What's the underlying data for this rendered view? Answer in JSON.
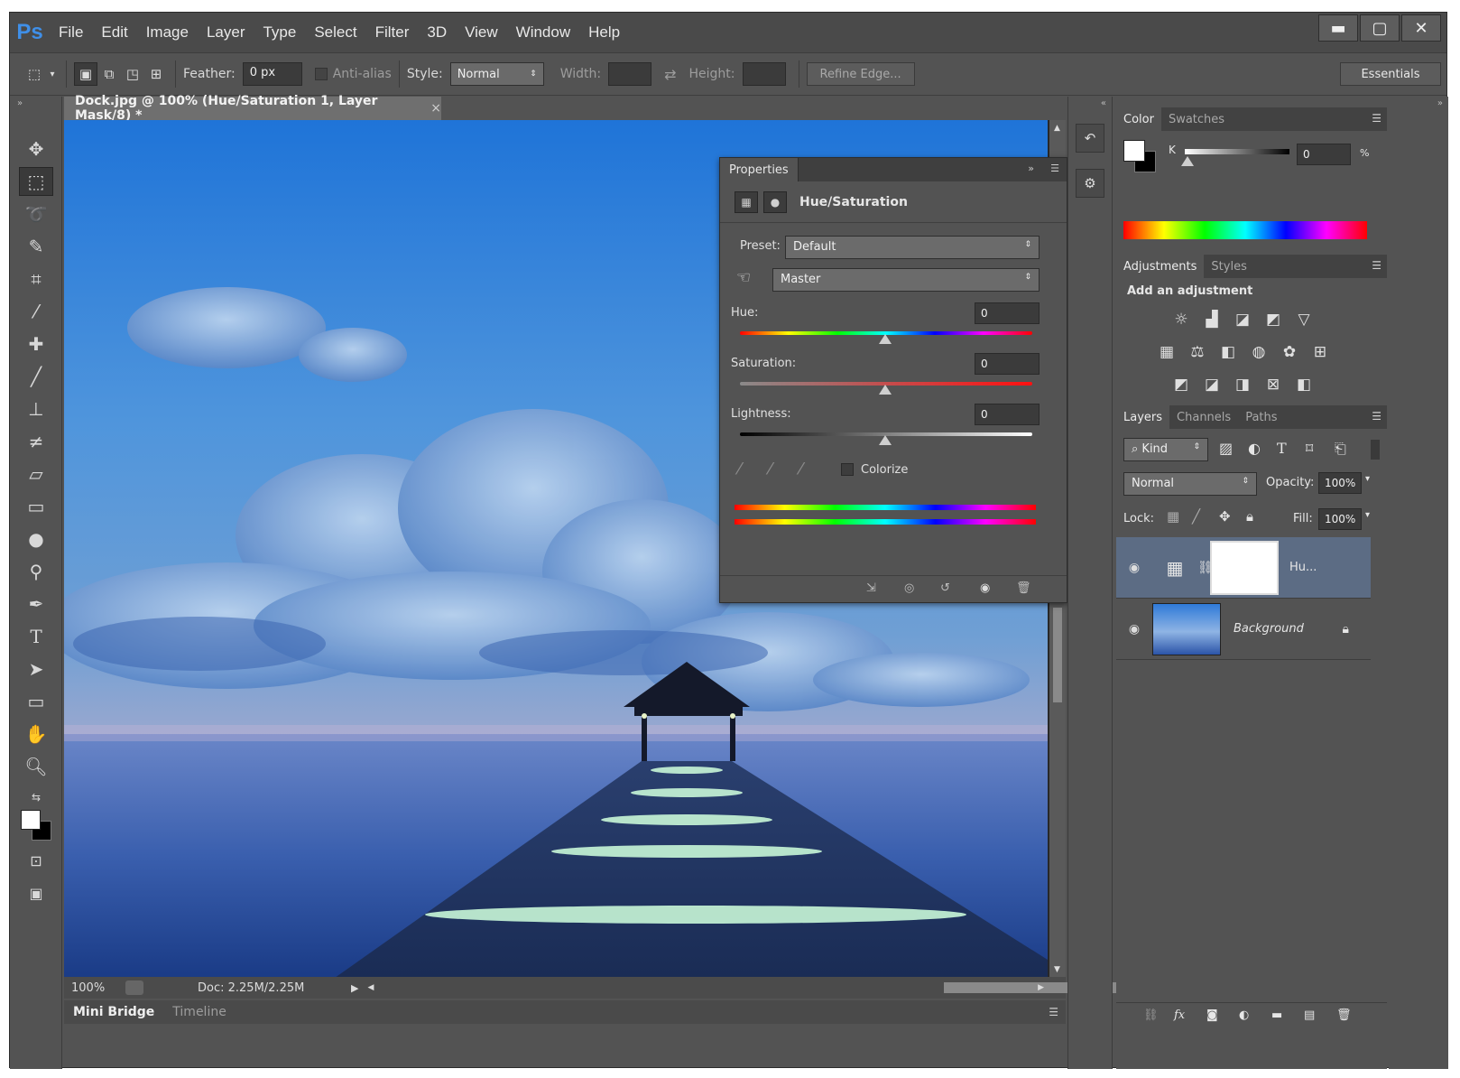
{
  "app": {
    "logo": "Ps"
  },
  "menu": [
    "File",
    "Edit",
    "Image",
    "Layer",
    "Type",
    "Select",
    "Filter",
    "3D",
    "View",
    "Window",
    "Help"
  ],
  "window_controls": {
    "minimize": "▬",
    "maximize": "▢",
    "close": "✕"
  },
  "options_bar": {
    "feather_label": "Feather:",
    "feather_value": "0 px",
    "antialias_label": "Anti-alias",
    "style_label": "Style:",
    "style_value": "Normal",
    "width_label": "Width:",
    "height_label": "Height:",
    "refine_edge": "Refine Edge...",
    "workspace": "Essentials"
  },
  "document": {
    "tab_title": "Dock.jpg @ 100% (Hue/Saturation 1, Layer Mask/8) *",
    "tab_close": "×",
    "zoom": "100%",
    "doc_info": "Doc: 2.25M/2.25M"
  },
  "bottom_tabs": [
    "Mini Bridge",
    "Timeline"
  ],
  "properties": {
    "tab": "Properties",
    "title": "Hue/Saturation",
    "preset_label": "Preset:",
    "preset_value": "Default",
    "channel_value": "Master",
    "hue_label": "Hue:",
    "hue_value": "0",
    "saturation_label": "Saturation:",
    "saturation_value": "0",
    "lightness_label": "Lightness:",
    "lightness_value": "0",
    "colorize_label": "Colorize"
  },
  "color_panel": {
    "tabs": [
      "Color",
      "Swatches"
    ],
    "k_label": "K",
    "k_value": "0",
    "percent": "%"
  },
  "adjustments_panel": {
    "tabs": [
      "Adjustments",
      "Styles"
    ],
    "heading": "Add an adjustment"
  },
  "layers_panel": {
    "tabs": [
      "Layers",
      "Channels",
      "Paths"
    ],
    "filter_kind": "Kind",
    "blend_mode": "Normal",
    "opacity_label": "Opacity:",
    "opacity_value": "100%",
    "lock_label": "Lock:",
    "fill_label": "Fill:",
    "fill_value": "100%",
    "layers": [
      {
        "name": "Hu...",
        "selected": true
      },
      {
        "name": "Background",
        "selected": false
      }
    ]
  },
  "colors": {
    "ui_bg": "#535353",
    "panel_header": "#424242",
    "selected_layer": "#5c6c84",
    "ps_blue": "#3f8fe8"
  }
}
